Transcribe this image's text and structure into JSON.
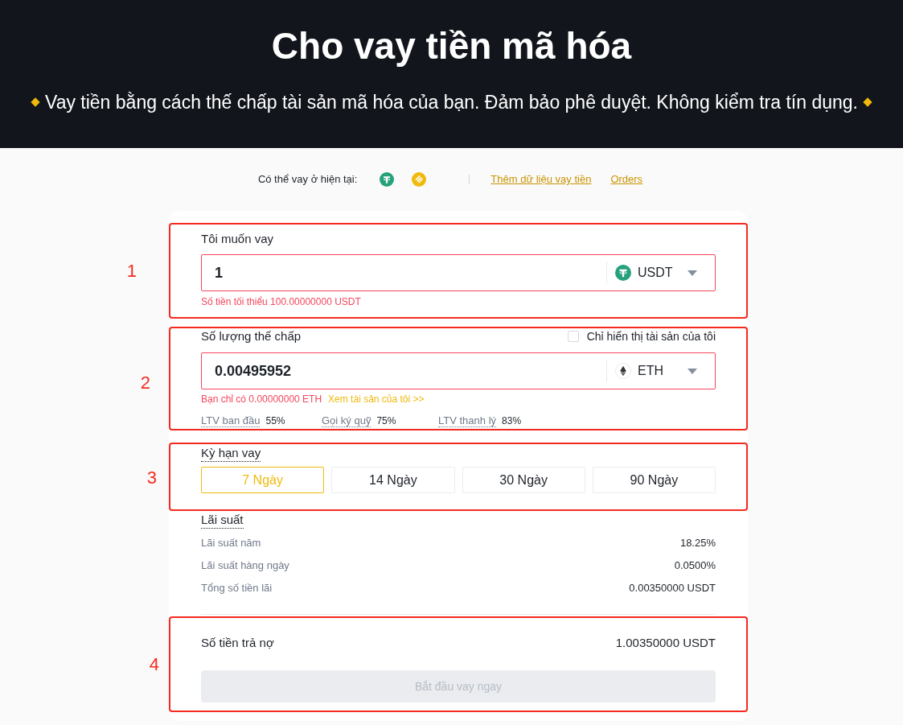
{
  "hero": {
    "title": "Cho vay tiền mã hóa",
    "subtitle": "Vay tiền bằng cách thế chấp tài sản mã hóa của bạn. Đảm bảo phê duyệt. Không kiểm tra tín dụng."
  },
  "availability": {
    "label": "Có thể vay ở hiện tại:",
    "coins": [
      {
        "kind": "tether"
      },
      {
        "kind": "busd"
      }
    ],
    "links": [
      "Thêm dữ liệu vay tiền",
      "Orders"
    ]
  },
  "loan": {
    "annotation": "1",
    "label": "Tôi muốn vay",
    "value": "1",
    "currency": {
      "kind": "tether",
      "code": "USDT"
    },
    "error": "Số tiền tối thiểu 100.00000000 USDT"
  },
  "collateral": {
    "annotation": "2",
    "label": "Số lượng thế chấp",
    "checkbox": {
      "label": "Chỉ hiển thị tài sản của tôi",
      "checked": false
    },
    "value": "0.00495952",
    "currency": {
      "kind": "eth",
      "code": "ETH"
    },
    "error": "Bạn chỉ có 0.00000000 ETH",
    "error_link": "Xem tài sản của tôi >>",
    "ltv": [
      {
        "label": "LTV ban đầu",
        "value": "55%"
      },
      {
        "label": "Gọi ký quỹ",
        "value": "75%"
      },
      {
        "label": "LTV thanh lý",
        "value": "83%"
      }
    ]
  },
  "term": {
    "annotation": "3",
    "label": "Kỳ hạn vay",
    "options": [
      {
        "label": "7 Ngày",
        "selected": true
      },
      {
        "label": "14 Ngày",
        "selected": false
      },
      {
        "label": "30 Ngày",
        "selected": false
      },
      {
        "label": "90 Ngày",
        "selected": false
      }
    ]
  },
  "interest": {
    "label": "Lãi suất",
    "rows": [
      {
        "label": "Lãi suất năm",
        "value": "18.25%"
      },
      {
        "label": "Lãi suất hàng ngày",
        "value": "0.0500%"
      },
      {
        "label": "Tổng số tiền lãi",
        "value": "0.00350000 USDT"
      }
    ]
  },
  "repayment": {
    "annotation": "4",
    "label": "Số tiền trả nợ",
    "value": "1.00350000 USDT",
    "button": {
      "label": "Bắt đầu vay ngay",
      "disabled": true
    }
  }
}
